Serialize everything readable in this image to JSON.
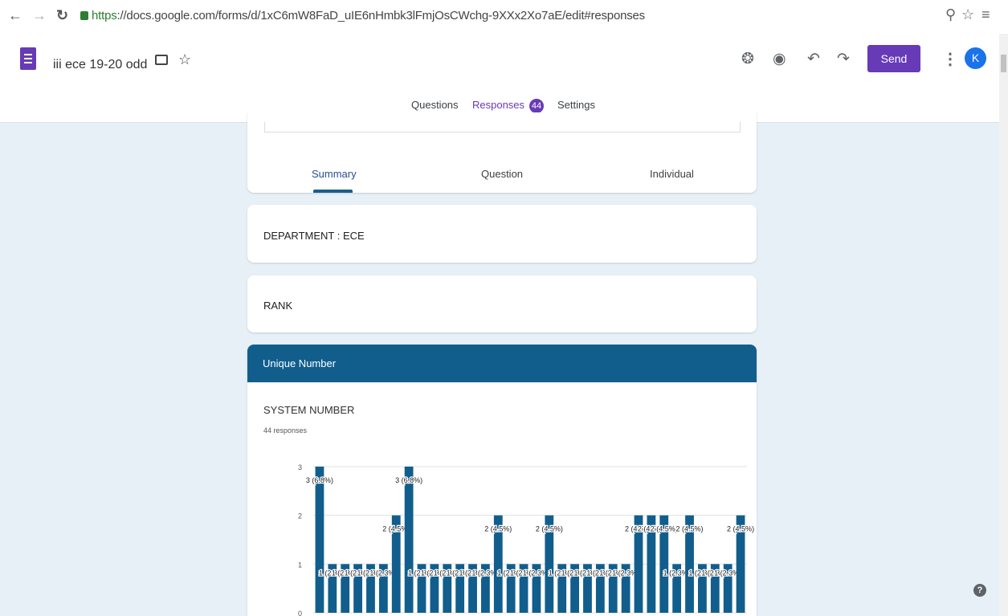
{
  "browser": {
    "url_https": "https",
    "url_rest": "://docs.google.com/forms/d/1xC6mW8FaD_uIE6nHmbk3lFmjOsCWchg-9XXx2Xo7aE/edit#responses"
  },
  "form": {
    "title": "iii ece 19-20 odd",
    "send_label": "Send",
    "avatar_letter": "K",
    "tabs": {
      "questions": "Questions",
      "responses": "Responses",
      "responses_count": "44",
      "settings": "Settings"
    }
  },
  "summary_tabs": {
    "summary": "Summary",
    "question": "Question",
    "individual": "Individual"
  },
  "cards": {
    "department": "DEPARTMENT : ECE",
    "rank": "RANK"
  },
  "section": {
    "header": "Unique Number",
    "question_title": "SYSTEM NUMBER",
    "responses_text": "44 responses"
  },
  "colors": {
    "accent": "#673ab7",
    "section_header": "#115e8d",
    "bar": "#115e8d",
    "page_background": "#e8f0f7"
  },
  "chart_data": {
    "type": "bar",
    "title": "",
    "xlabel": "",
    "ylabel": "",
    "ylim": [
      0,
      3
    ],
    "y_ticks": [
      0,
      1,
      2,
      3
    ],
    "grid": true,
    "values": [
      3,
      1,
      1,
      1,
      1,
      1,
      2,
      3,
      1,
      1,
      1,
      1,
      1,
      1,
      2,
      1,
      1,
      1,
      2,
      1,
      1,
      1,
      1,
      1,
      1,
      2,
      2,
      2,
      1,
      2,
      1,
      1,
      1,
      2
    ],
    "labels": [
      "3 (6.8%)",
      "1 (2.3%)",
      "1 (2.3%)",
      "1 (2.3%)",
      "1 (2.3%)",
      "1 (2.3%)",
      "2 (4.5%)",
      "3 (6.8%)",
      "1 (2.3%)",
      "1 (2.3%)",
      "1 (2.3%)",
      "1 (2.3%)",
      "1 (2.3%)",
      "1 (2.3%)",
      "2 (4.5%)",
      "1 (2.3%)",
      "1 (2.3%)",
      "1 (2.3%)",
      "2 (4.5%)",
      "1 (2.3%)",
      "1 (2.3%)",
      "1 (2.3%)",
      "1 (2.3%)",
      "1 (2.3%)",
      "1 (2.3%)",
      "2 (4.5%)",
      "2 (4.5%)",
      "2 (4.5%)",
      "1 (2.3%)",
      "2 (4.5%)",
      "1 (2.3%)",
      "1 (2.3%)",
      "1 (2.3%)",
      "2 (4.5%)"
    ]
  }
}
